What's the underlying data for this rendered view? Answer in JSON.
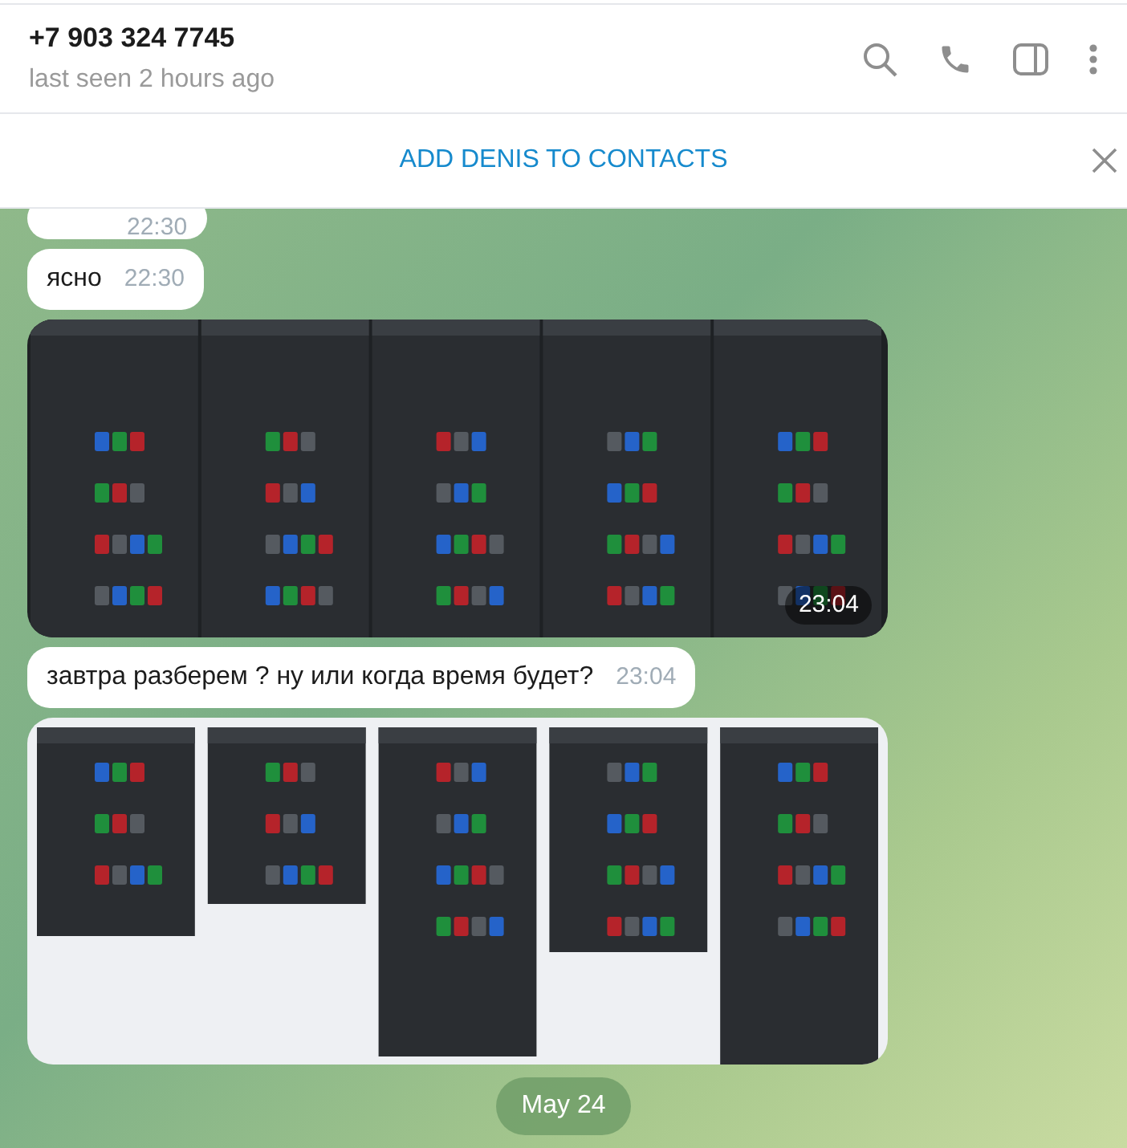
{
  "header": {
    "title": "+7 903 324 7745",
    "subtitle": "last seen 2 hours ago"
  },
  "banner": {
    "label": "ADD DENIS TO CONTACTS"
  },
  "messages": [
    {
      "kind": "text",
      "time": "22:30"
    },
    {
      "kind": "text",
      "text": "ясно",
      "time": "22:30"
    },
    {
      "kind": "album",
      "time": "23:04"
    },
    {
      "kind": "text",
      "text": "завтра разберем ? ну или когда время будет?",
      "time": "23:04"
    },
    {
      "kind": "album"
    }
  ],
  "date_pill": "May 24"
}
